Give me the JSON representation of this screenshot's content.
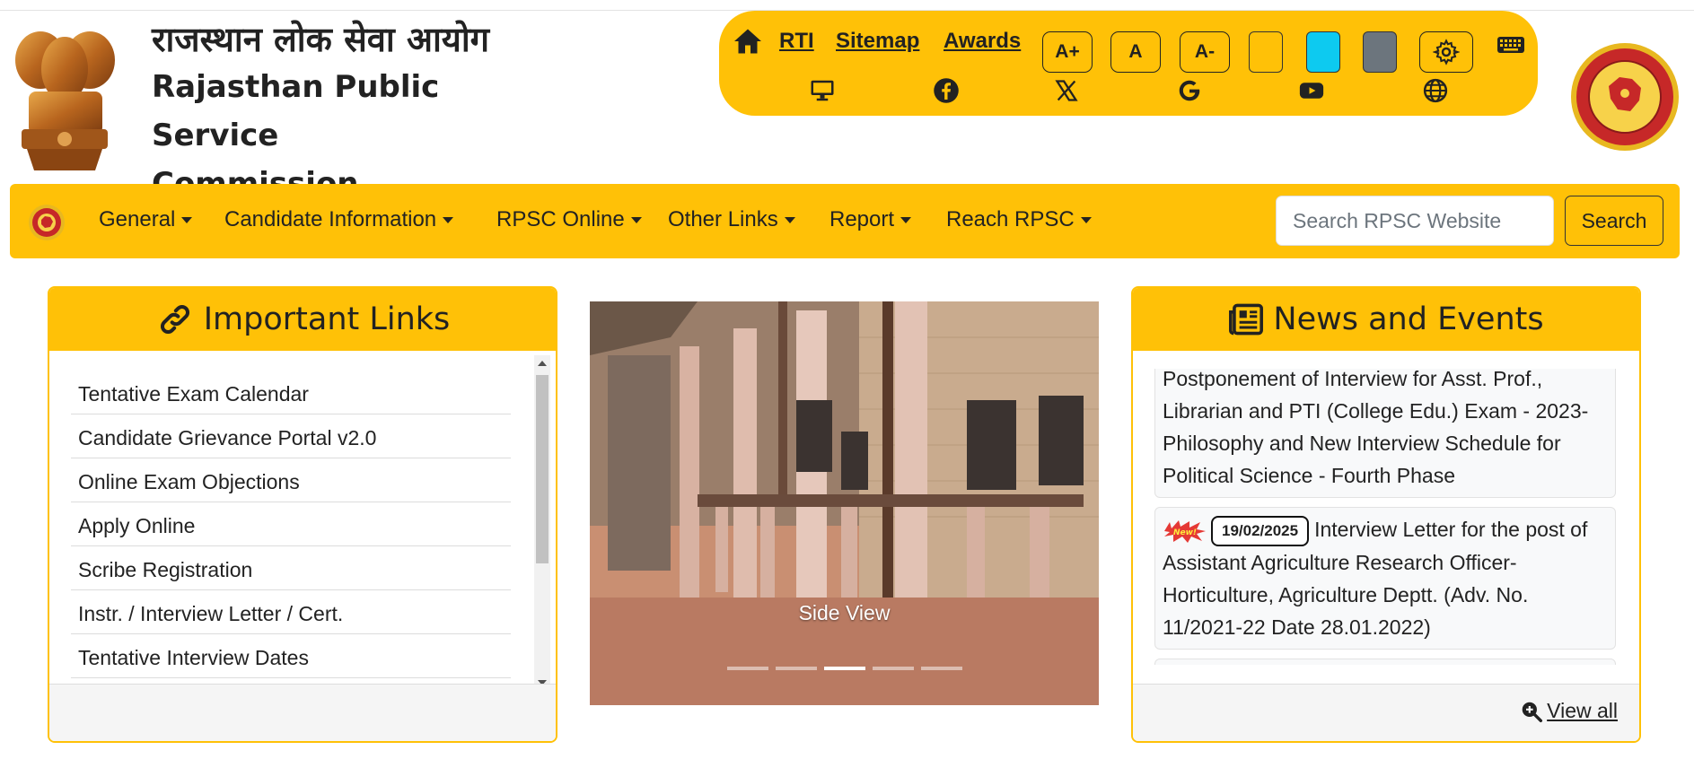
{
  "header": {
    "title_hindi": "राजस्थान लोक सेवा आयोग",
    "title_en_line1": "Rajasthan Public Service",
    "title_en_line2": "Commission"
  },
  "toolbar": {
    "links": [
      "RTI",
      "Sitemap",
      "Awards"
    ],
    "font_buttons": [
      "A+",
      "A",
      "A-"
    ],
    "swatches": [
      "#ffc107",
      "#0dcaf0",
      "#6c757d"
    ],
    "icons_row1": [
      "home-icon",
      "gear-icon",
      "keyboard-icon"
    ],
    "icons_row2": [
      "monitor-icon",
      "facebook-icon",
      "x-icon",
      "google-icon",
      "youtube-icon",
      "globe-icon"
    ]
  },
  "nav": {
    "items": [
      "General",
      "Candidate Information",
      "RPSC Online",
      "Other Links",
      "Report",
      "Reach RPSC"
    ],
    "search_placeholder": "Search RPSC Website",
    "search_button": "Search"
  },
  "important_links": {
    "title": "Important Links",
    "items": [
      "Tentative Exam Calendar",
      "Candidate Grievance Portal v2.0",
      "Online Exam Objections",
      "Apply Online",
      "Scribe Registration",
      "Instr. / Interview Letter / Cert.",
      "Tentative Interview Dates"
    ]
  },
  "carousel": {
    "caption": "Side View",
    "slide_count": 5,
    "active_index": 2
  },
  "news": {
    "title": "News and Events",
    "items": [
      {
        "date": "",
        "text": "Postponement of Interview for Asst. Prof., Librarian and PTI (College Edu.) Exam - 2023- Philosophy and New Interview Schedule for Political Science - Fourth Phase"
      },
      {
        "date": "19/02/2025",
        "text": "Interview Letter for the post of Assistant Agriculture Research Officer- Horticulture, Agriculture Deptt. (Adv. No. 11/2021-22 Date 28.01.2022)"
      }
    ],
    "view_all": "View all"
  },
  "colors": {
    "brand_yellow": "#ffc107",
    "text_dark": "#222222"
  }
}
